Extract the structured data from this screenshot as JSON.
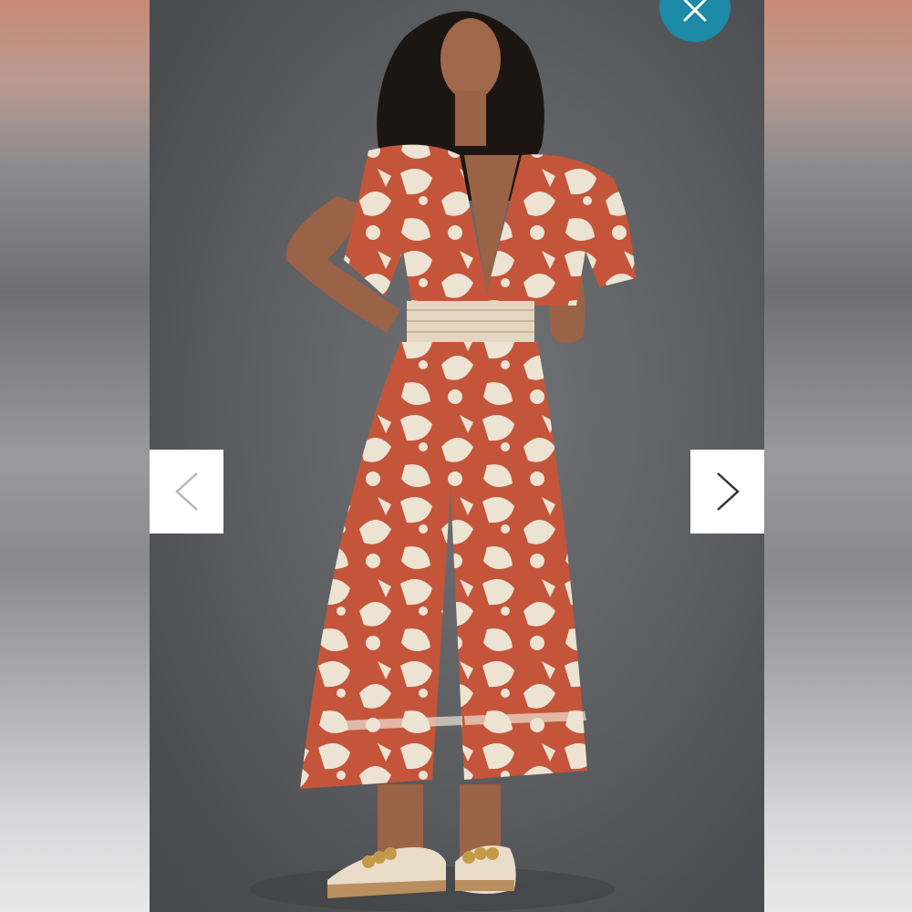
{
  "viewer": {
    "photo_subject": "product-photo",
    "colors": {
      "close_button": "#1d8aa7",
      "nav_background": "#ffffff",
      "prev_arrow": "#b8b8b8",
      "next_arrow": "#333333",
      "print_rust": "#c4553a",
      "print_cream": "#ece3d3"
    },
    "icons": {
      "close": "close-icon",
      "previous": "chevron-left-icon",
      "next": "chevron-right-icon"
    }
  }
}
